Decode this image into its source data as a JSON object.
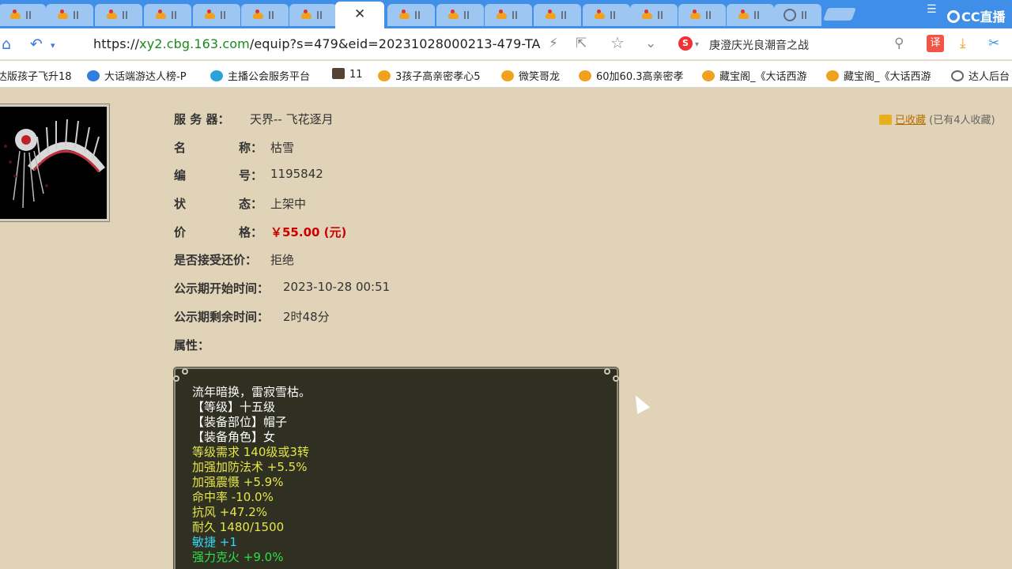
{
  "tabs": {
    "count_inactive": 16,
    "active_close": "✕"
  },
  "window": {
    "brand": "CC直播"
  },
  "addressbar": {
    "url_prefix": "https://",
    "url_domain": "xy2.cbg.163.com",
    "url_path": "/equip?s=479&eid=20231028000213-479-TA",
    "search_engine_icon": "S",
    "search_text": "庚澄庆光良潮音之战",
    "translate_label": "译"
  },
  "bookmarks": [
    {
      "label": "达版孩子飞升18"
    },
    {
      "label": "大话端游达人榜-P"
    },
    {
      "label": "主播公会服务平台"
    },
    {
      "label": "11"
    },
    {
      "label": "3孩子高亲密孝心5"
    },
    {
      "label": "微笑哥龙"
    },
    {
      "label": "60加60.3高亲密孝"
    },
    {
      "label": "藏宝阁_《大话西游"
    },
    {
      "label": "藏宝阁_《大话西游"
    },
    {
      "label": "达人后台"
    }
  ],
  "item": {
    "server_label": "服 务 器：",
    "server_value": "天界-- 飞花逐月",
    "name_label_a": "名",
    "name_label_b": "称：",
    "name_value": "枯雪",
    "id_label_a": "编",
    "id_label_b": "号：",
    "id_value": "1195842",
    "status_label_a": "状",
    "status_label_b": "态：",
    "status_value": "上架中",
    "price_label_a": "价",
    "price_label_b": "格：",
    "price_value": "￥55.00 (元)",
    "bargain_label": "是否接受还价：",
    "bargain_value": "拒绝",
    "start_label": "公示期开始时间：",
    "start_value": "2023-10-28 00:51",
    "remain_label": "公示期剩余时间：",
    "remain_value": "2时48分",
    "attr_label": "属性："
  },
  "collect": {
    "link": "已收藏",
    "count": "(已有4人收藏)"
  },
  "properties": [
    {
      "text": "流年暗换，雷寂雪枯。",
      "color": "w"
    },
    {
      "text": "【等级】十五级",
      "color": "w"
    },
    {
      "text": "【装备部位】帽子",
      "color": "w"
    },
    {
      "text": "【装备角色】女",
      "color": "w"
    },
    {
      "text": "等级需求 140级或3转",
      "color": "y"
    },
    {
      "text": "加强加防法术 +5.5%",
      "color": "y"
    },
    {
      "text": "加强震慑 +5.9%",
      "color": "y"
    },
    {
      "text": "命中率 -10.0%",
      "color": "y"
    },
    {
      "text": "抗风 +47.2%",
      "color": "y"
    },
    {
      "text": "耐久 1480/1500",
      "color": "y"
    },
    {
      "text": "敏捷 +1",
      "color": "c"
    },
    {
      "text": "强力克火 +9.0%",
      "color": "g"
    }
  ]
}
